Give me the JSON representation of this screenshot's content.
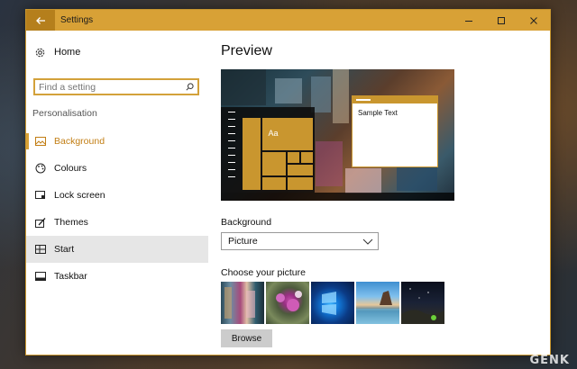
{
  "window": {
    "title": "Settings"
  },
  "sidebar": {
    "home_label": "Home",
    "search_placeholder": "Find a setting",
    "section_title": "Personalisation",
    "items": [
      {
        "label": "Background",
        "icon": "picture-icon",
        "active": true
      },
      {
        "label": "Colours",
        "icon": "palette-icon"
      },
      {
        "label": "Lock screen",
        "icon": "lock-screen-icon"
      },
      {
        "label": "Themes",
        "icon": "brush-icon"
      },
      {
        "label": "Start",
        "icon": "start-icon",
        "hover": true
      },
      {
        "label": "Taskbar",
        "icon": "taskbar-icon"
      }
    ]
  },
  "main": {
    "title": "Preview",
    "preview": {
      "tile_label": "Aa",
      "sample_text": "Sample Text"
    },
    "background_label": "Background",
    "background_value": "Picture",
    "choose_label": "Choose your picture",
    "pictures": [
      "street-market-photo",
      "pink-flower-photo",
      "windows-hero-photo",
      "beach-rock-photo",
      "night-sky-photo"
    ],
    "browse_label": "Browse"
  },
  "watermark": "GENK",
  "colors": {
    "accent": "#d8a136",
    "accent_text": "#c27e14"
  }
}
